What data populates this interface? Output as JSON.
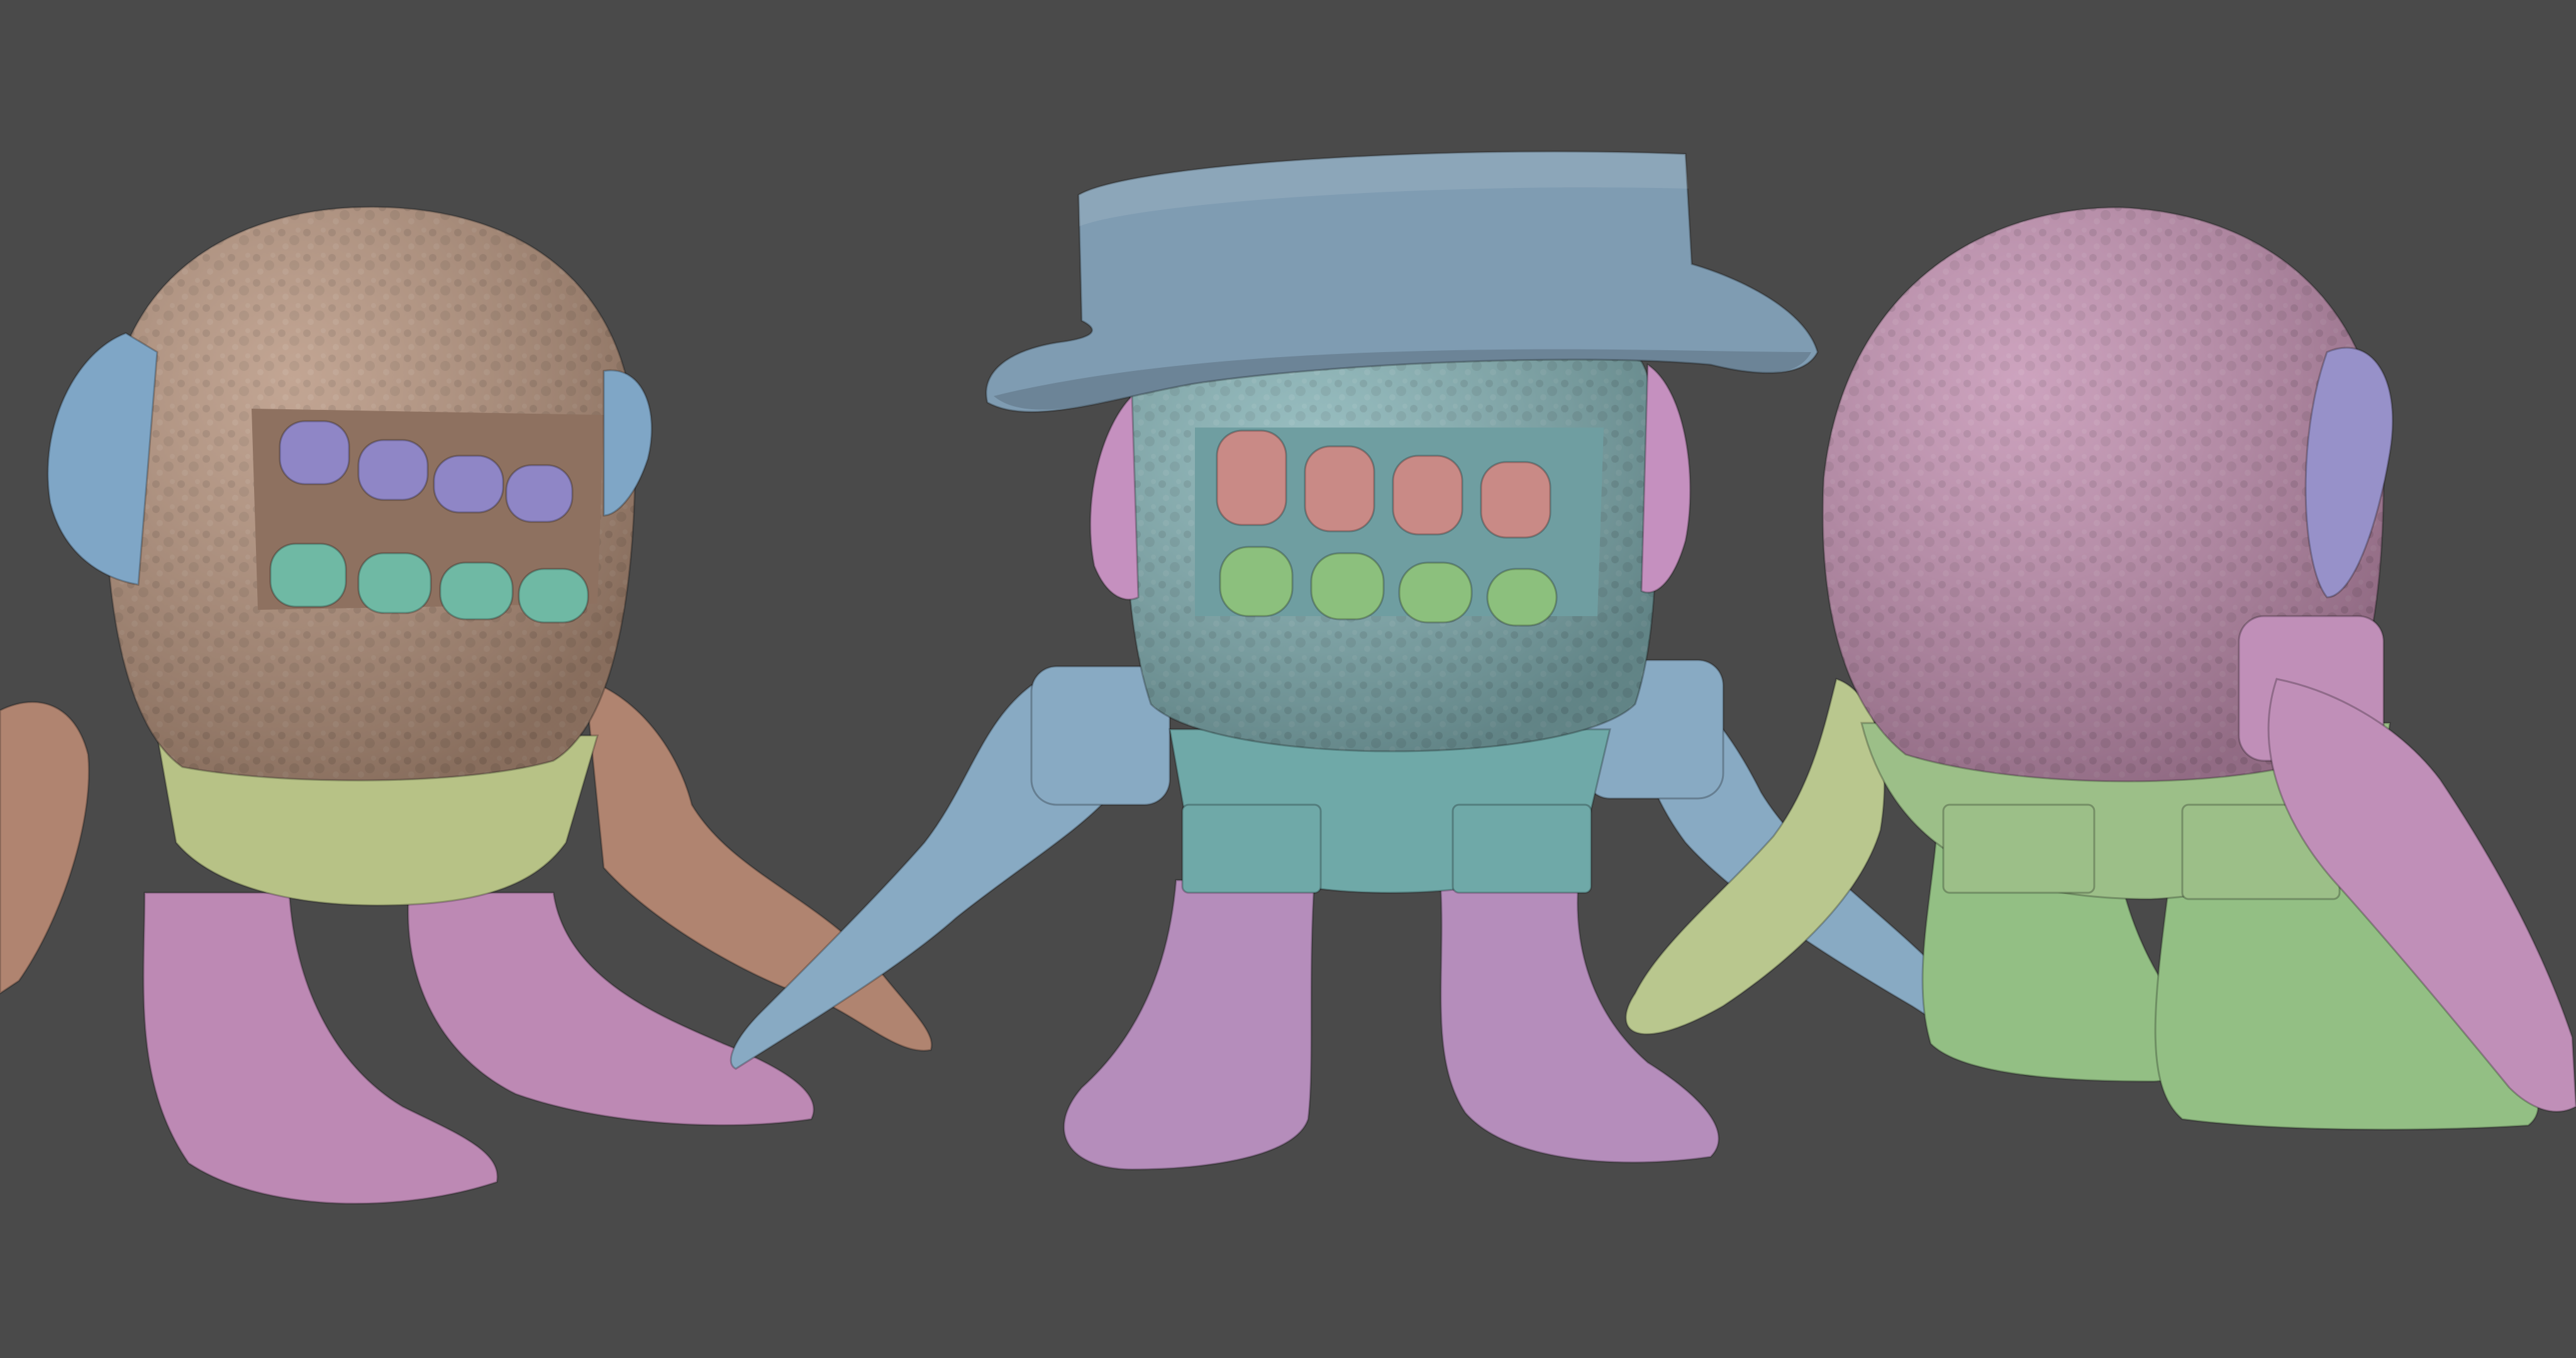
{
  "scene": {
    "background": "#4a4a4a",
    "characters": [
      {
        "name": "left-character",
        "view": "three-quarter-left",
        "colors": {
          "head": "#b5927c",
          "ears": "#7fa6c6",
          "upper_teeth": "#8f86c6",
          "lower_teeth": "#6fb9a4",
          "collar": "#b7c286",
          "legs": "#bd89b4",
          "arms": "#b08470"
        }
      },
      {
        "name": "center-character",
        "view": "front",
        "colors": {
          "hat": "#7f9cb2",
          "head": "#82b0b3",
          "ears": "#c590bf",
          "upper_teeth": "#c98a86",
          "lower_teeth": "#8cc07d",
          "collar": "#6fa9a8",
          "legs": "#b58dbb",
          "arms": "#88aac3"
        }
      },
      {
        "name": "right-character",
        "view": "back-three-quarter",
        "colors": {
          "head": "#c28fb0",
          "ears": "#9791c9",
          "collar": "#9cbf88",
          "legs": "#93bf84",
          "arms": "#c08fb8",
          "left_hand": "#b9c78e"
        }
      }
    ]
  }
}
